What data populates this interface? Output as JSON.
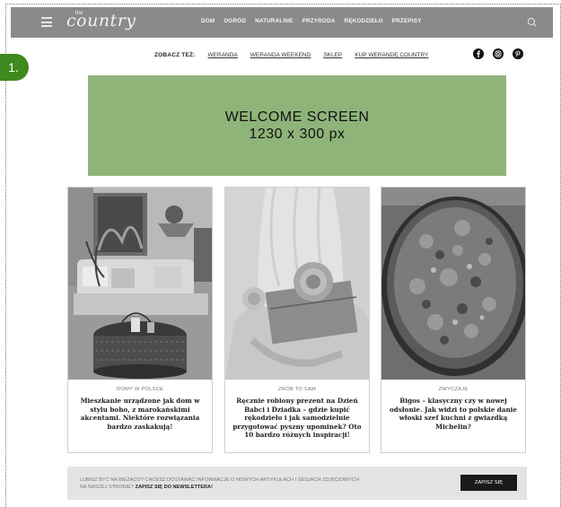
{
  "header": {
    "logo_small": "the",
    "logo": "country",
    "nav": [
      "DOM",
      "OGRÓD",
      "NATURALNIE",
      "PRZYRODA",
      "RĘKODZIEŁO",
      "PRZEPISY"
    ]
  },
  "step_badge": "1.",
  "see_also": {
    "label": "ZOBACZ TEŻ:",
    "links": [
      "WERANDA",
      "WERANDA WEEKEND",
      "SKLEP",
      "KUP WERANDĘ COUNTRY"
    ]
  },
  "socials": [
    "facebook-icon",
    "instagram-icon",
    "pinterest-icon"
  ],
  "welcome": {
    "line1": "WELCOME SCREEN",
    "line2": "1230 x 300 px",
    "color": "#8fb47a"
  },
  "cards": [
    {
      "category": "DOMY W POLSCE",
      "title": "Mieszkanie urządzone jak dom w stylu boho, z marokańskimi akcentami. Niektóre rozwiązania bardzo zaskakują!"
    },
    {
      "category": "ZRÓB TO SAM",
      "title": "Ręcznie robiony prezent na Dzień Babci i Dziadka – gdzie kupić rękodzieło i jak samodzielnie przygotować pyszny upominek? Oto 10 bardzo różnych inspiracji!"
    },
    {
      "category": "ZWYCZAJE",
      "title": "Bigos – klasyczny czy w nowej odsłonie. Jak widzi to polskie danie włoski szef kuchni z gwiazdką Michelin?"
    }
  ],
  "newsletter": {
    "text_part1": "LUBISZ BYĆ NA BIEŻĄCO? CHCESZ DOSTAWAĆ INFORMACJE O NOWYCH ARTYKUŁACH I SESJACH ZDJĘCIOWYCH NA NASZEJ STRONIE?",
    "text_bold": "ZAPISZ SIĘ DO NEWSLETTERA!",
    "button": "ZAPISZ SIĘ"
  },
  "colors": {
    "nav_bg": "#8a8a8a",
    "badge": "#3f8a1f",
    "button": "#1a1a1a"
  }
}
